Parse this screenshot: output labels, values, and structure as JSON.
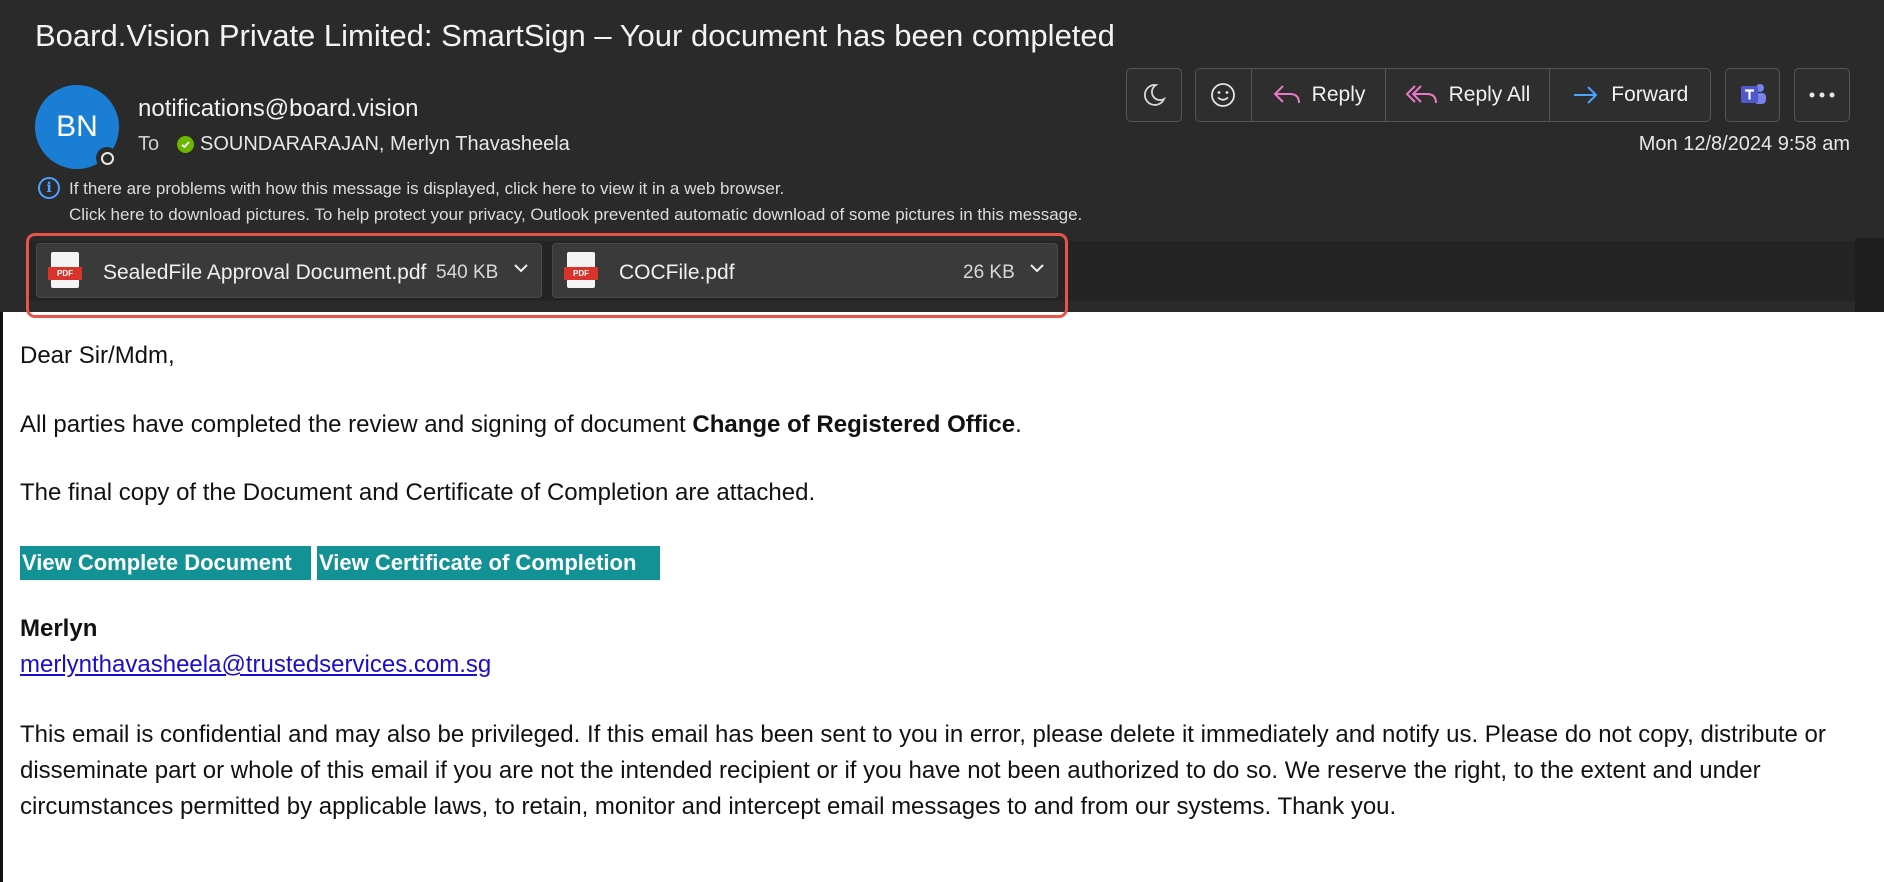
{
  "email": {
    "subject": "Board.Vision Private Limited: SmartSign – Your document has been completed",
    "sender_initials": "BN",
    "sender_email": "notifications@board.vision",
    "to_label": "To",
    "recipient": "SOUNDARARAJAN, Merlyn Thavasheela",
    "date": "Mon 12/8/2024 9:58 am",
    "info_line_1": "If there are problems with how this message is displayed, click here to view it in a web browser.",
    "info_line_2": "Click here to download pictures. To help protect your privacy, Outlook prevented automatic download of some pictures in this message."
  },
  "toolbar": {
    "reply": "Reply",
    "reply_all": "Reply All",
    "forward": "Forward"
  },
  "attachments": [
    {
      "name": "SealedFile Approval Document.pdf",
      "size": "540 KB",
      "icon": "pdf-icon"
    },
    {
      "name": "COCFile.pdf",
      "size": "26 KB",
      "icon": "pdf-icon"
    }
  ],
  "body": {
    "greeting": "Dear Sir/Mdm,",
    "line1_prefix": "All parties have completed the review and signing of document ",
    "line1_bold": "Change of Registered Office",
    "line1_suffix": ".",
    "line2": "The final copy of the Document and Certificate of Completion are attached.",
    "button_view_document": "View Complete Document",
    "button_view_certificate": "View Certificate of Completion",
    "signature_name": "Merlyn",
    "signature_email": "merlynthavasheela@trustedservices.com.sg",
    "disclaimer": "This email is confidential and may also be privileged. If this email has been sent to you in error, please delete it immediately and notify us. Please do not copy, distribute or disseminate part or whole of this email if you are not the intended recipient or if you have not been authorized to do so. We reserve the right, to the extent and under circumstances permitted by applicable laws, to retain, monitor and intercept email messages to and from our systems. Thank you."
  },
  "colors": {
    "header_bg": "#2a2a2a",
    "avatar": "#1a7fd4",
    "button_teal": "#139296",
    "link": "#1a0dcc",
    "highlight": "#e8544a",
    "reply_icon": "#e879c4",
    "forward_icon": "#4aa3ff",
    "presence_green": "#6bb700"
  }
}
